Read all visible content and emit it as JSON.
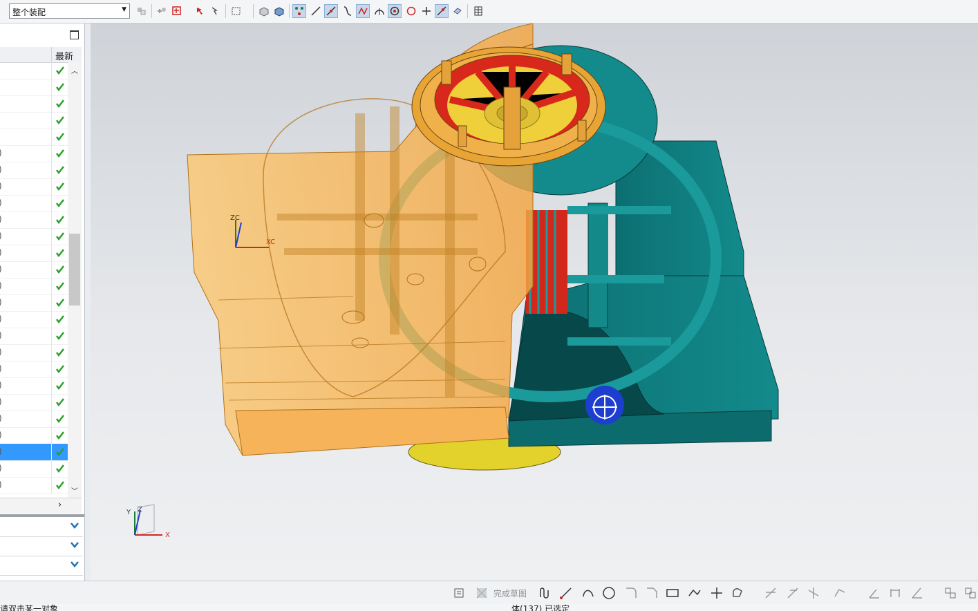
{
  "toolbar": {
    "filter_value": "整个装配",
    "icons": [
      "general-selection-icon",
      "snap-point-icon",
      "selection-scope-icon",
      "select-region-icon",
      "rectangle-select-icon",
      "view-body-icon",
      "shaded-body-icon",
      "endpoint-snap-icon",
      "midpoint-snap-icon",
      "control-point-icon",
      "intersection-icon",
      "arc-center-icon",
      "quadrant-point-icon",
      "tangent-point-icon",
      "existing-point-icon",
      "point-on-curve-icon",
      "point-on-surface-icon",
      "bounded-grid-icon",
      "table-icon"
    ]
  },
  "navigator": {
    "column_latest": "最新",
    "rows_count_visible": 26,
    "selected_row": 23,
    "status": "up-to-date"
  },
  "viewport": {
    "csys_labels": {
      "x": "XC",
      "z": "ZC"
    },
    "triad_labels": {
      "x": "X",
      "y": "Y",
      "z": "Z"
    },
    "colors": {
      "cavity": "#f7b14a",
      "core": "#0f7f80",
      "core_dark": "#0a5f62",
      "insert_red": "#e8271c",
      "insert_yellow": "#efd03a",
      "cursor": "#1e3ecf"
    }
  },
  "sketch_toolbar": {
    "finish_label": "完成草图"
  },
  "status": {
    "left": "请双击某一对象",
    "middle": "体(137) 已选定"
  }
}
